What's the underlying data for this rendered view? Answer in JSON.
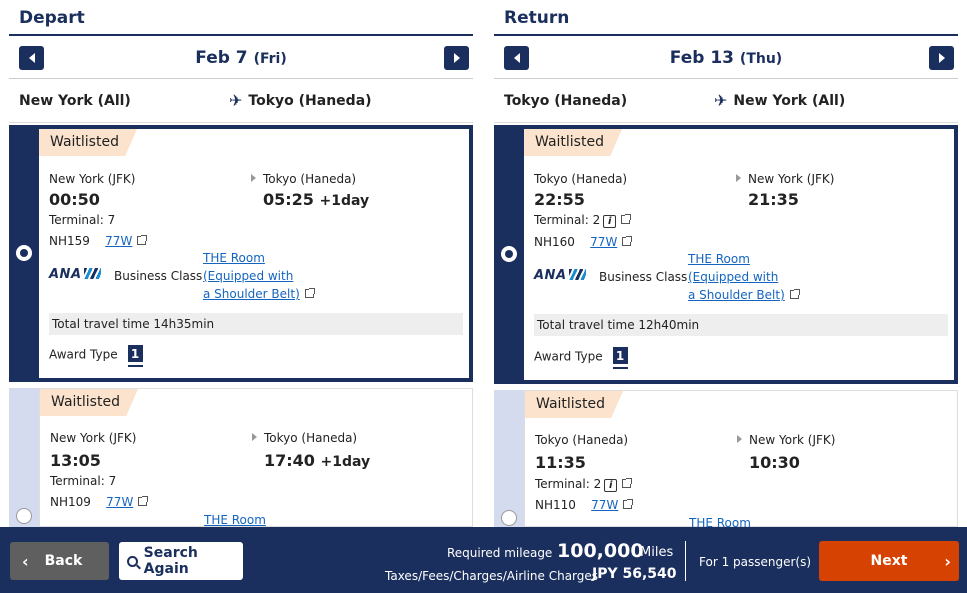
{
  "depart": {
    "title": "Depart",
    "date": "Feb 7",
    "dow": "(Fri)",
    "from": "New York (All)",
    "to": "Tokyo (Haneda)",
    "flights": [
      {
        "status": "Waitlisted",
        "origin": "New York (JFK)",
        "dest": "Tokyo (Haneda)",
        "dep_time": "00:50",
        "arr_time": "05:25",
        "arr_offset": "+1day",
        "terminal": "Terminal: 7",
        "flight_no": "NH159",
        "aircraft": "77W",
        "airline": "ANA",
        "cabin": "Business Class",
        "seat_line1": "THE Room",
        "seat_line2": "(Equipped with",
        "seat_line3": "a Shoulder Belt)",
        "total_time": "Total travel time 14h35min",
        "award_label": "Award Type",
        "award_num": "1"
      },
      {
        "status": "Waitlisted",
        "origin": "New York (JFK)",
        "dest": "Tokyo (Haneda)",
        "dep_time": "13:05",
        "arr_time": "17:40",
        "arr_offset": "+1day",
        "terminal": "Terminal: 7",
        "flight_no": "NH109",
        "aircraft": "77W",
        "seat_line1": "THE Room"
      }
    ]
  },
  "return": {
    "title": "Return",
    "date": "Feb 13",
    "dow": "(Thu)",
    "from": "Tokyo (Haneda)",
    "to": "New York (All)",
    "flights": [
      {
        "status": "Waitlisted",
        "origin": "Tokyo (Haneda)",
        "dest": "New York (JFK)",
        "dep_time": "22:55",
        "arr_time": "21:35",
        "terminal": "Terminal: 2",
        "flight_no": "NH160",
        "aircraft": "77W",
        "airline": "ANA",
        "cabin": "Business Class",
        "seat_line1": "THE Room",
        "seat_line2": "(Equipped with",
        "seat_line3": "a Shoulder Belt)",
        "total_time": "Total travel time 12h40min",
        "award_label": "Award Type",
        "award_num": "1"
      },
      {
        "status": "Waitlisted",
        "origin": "Tokyo (Haneda)",
        "dest": "New York (JFK)",
        "dep_time": "11:35",
        "arr_time": "10:30",
        "terminal": "Terminal: 2",
        "flight_no": "NH110",
        "aircraft": "77W",
        "seat_line1": "THE Room"
      }
    ]
  },
  "footer": {
    "back_label": "Back",
    "search_again_label": "Search Again",
    "mileage_label": "Required mileage",
    "mileage_value": "100,000",
    "mileage_unit": "Miles",
    "taxes_label": "Taxes/Fees/Charges/Airline Charges",
    "taxes_value": "JPY  56,540",
    "passengers": "For 1 passenger(s)",
    "next_label": "Next"
  },
  "colors": {
    "navy": "#1b2f5e",
    "next_orange": "#d64202",
    "status_bg": "#fbe3cd",
    "unselected_bg": "#d4dbef",
    "link": "#1565c0"
  },
  "icons": [
    "left-arrow-icon",
    "right-arrow-icon",
    "airplane-icon",
    "external-link-icon",
    "info-icon",
    "search-icon",
    "chevron-left-icon",
    "chevron-right-icon"
  ]
}
